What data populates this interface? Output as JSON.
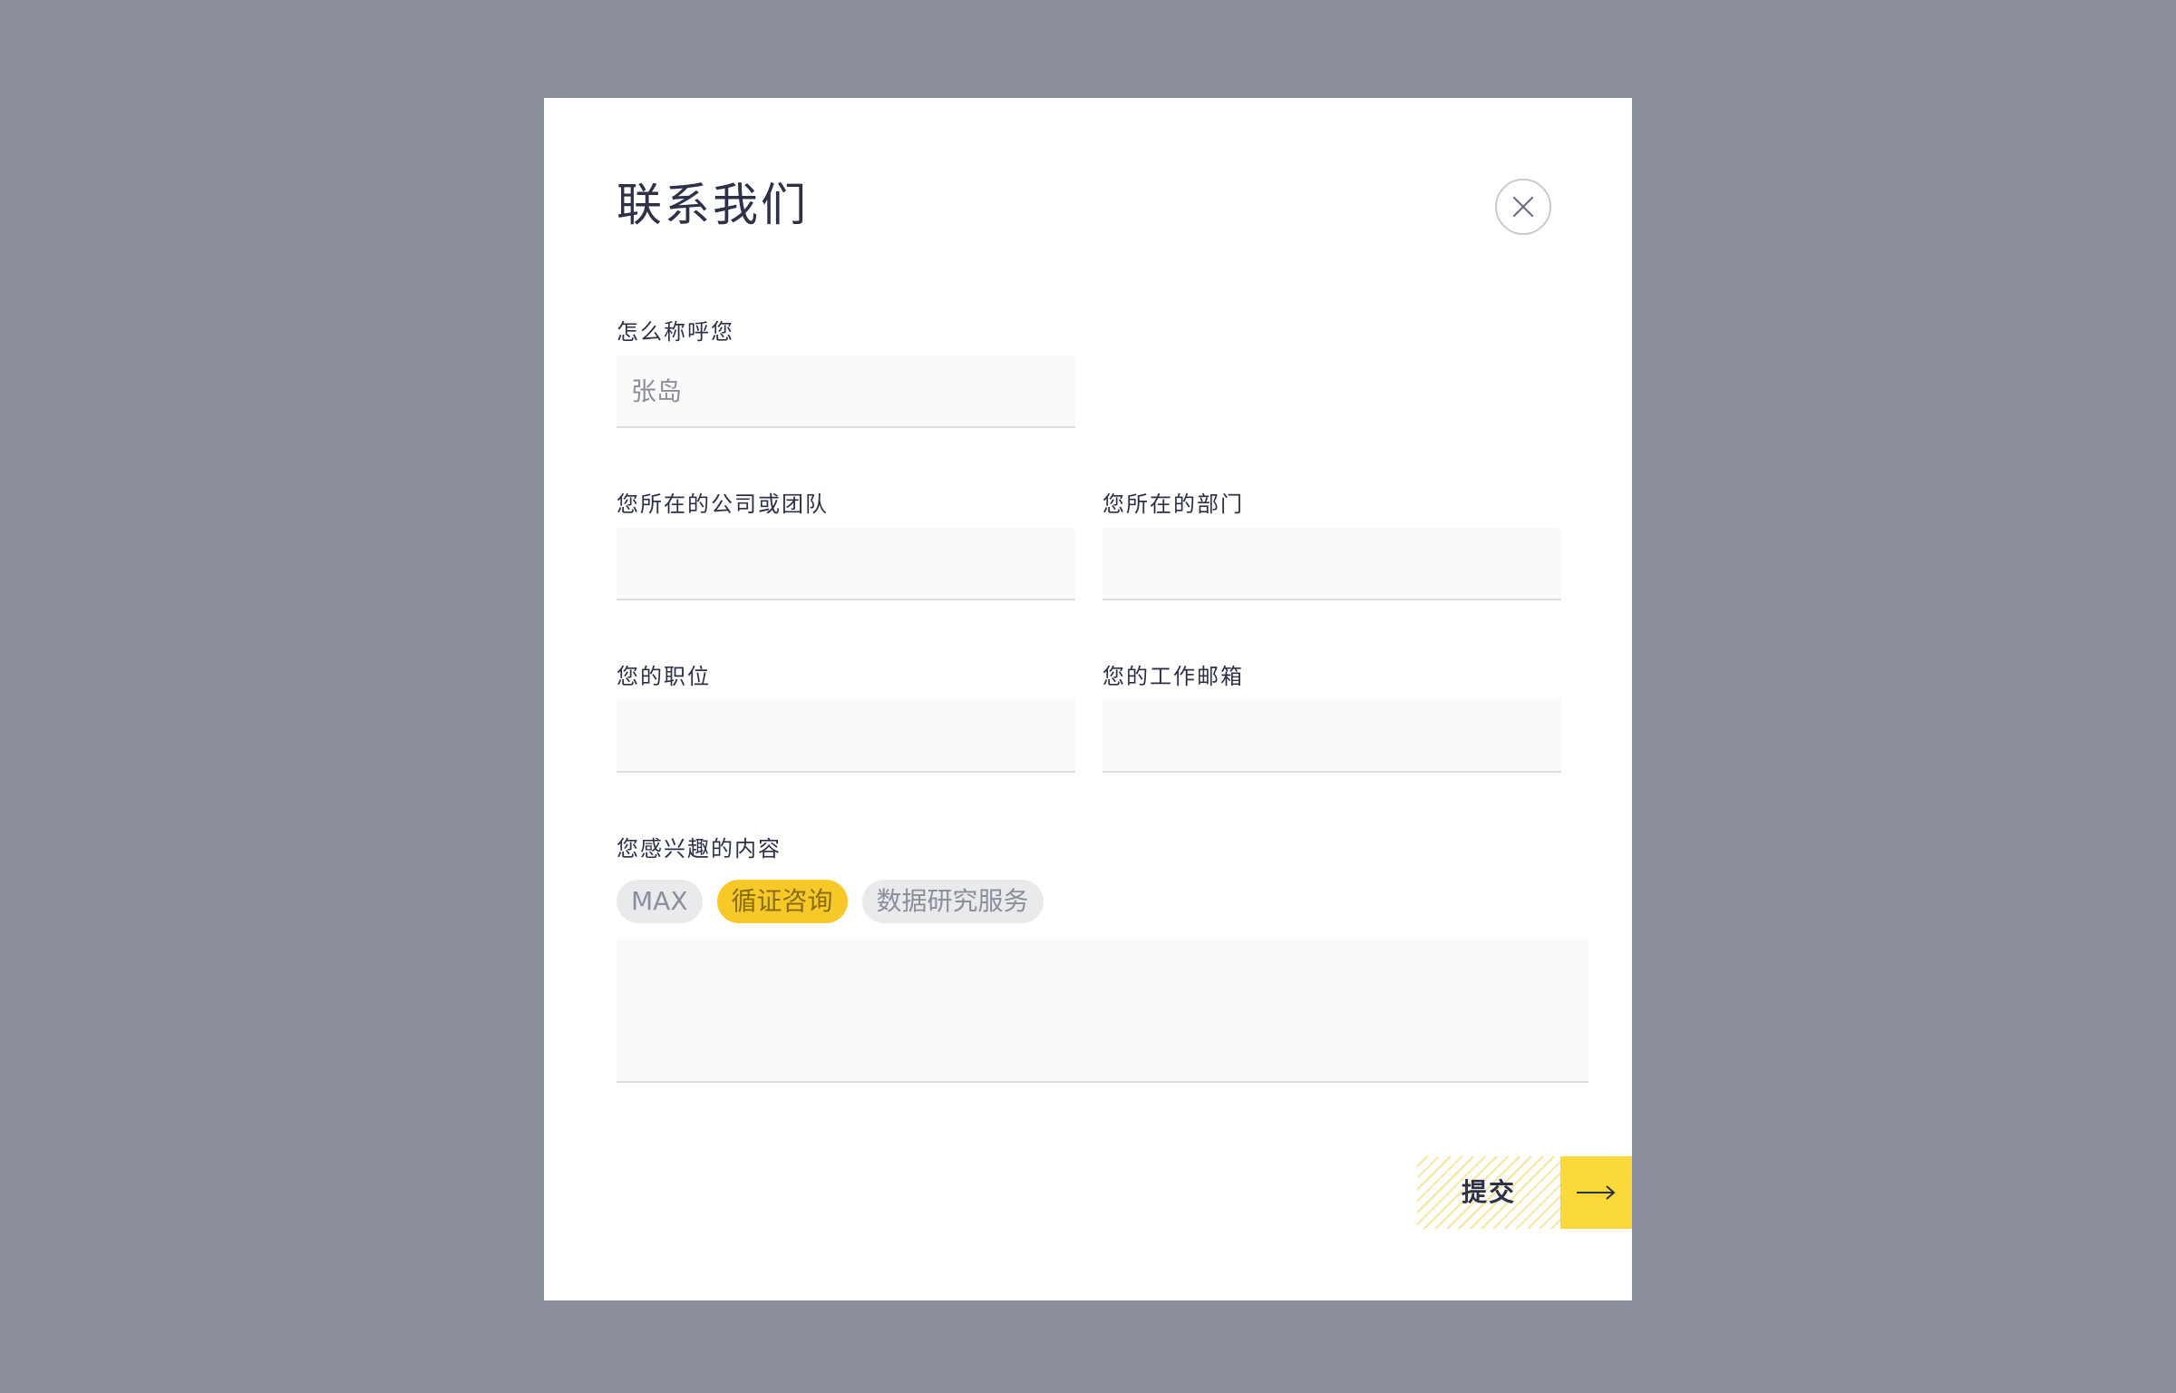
{
  "modal": {
    "title": "联系我们",
    "close_icon": "close-icon"
  },
  "form": {
    "name": {
      "label": "怎么称呼您",
      "placeholder": "张岛",
      "value": ""
    },
    "company": {
      "label": "您所在的公司或团队",
      "value": ""
    },
    "department": {
      "label": "您所在的部门",
      "value": ""
    },
    "position": {
      "label": "您的职位",
      "value": ""
    },
    "email": {
      "label": "您的工作邮箱",
      "value": ""
    },
    "interests": {
      "label": "您感兴趣的内容",
      "tags": [
        {
          "label": "MAX",
          "selected": false
        },
        {
          "label": "循证咨询",
          "selected": true
        },
        {
          "label": "数据研究服务",
          "selected": false
        }
      ],
      "message": ""
    }
  },
  "submit": {
    "label": "提交",
    "arrow_icon": "arrow-right-icon"
  },
  "colors": {
    "overlay": "#8b8e9b",
    "accent": "#fbd93b",
    "selected_tag": "#f6c928",
    "text": "#2c3148"
  }
}
